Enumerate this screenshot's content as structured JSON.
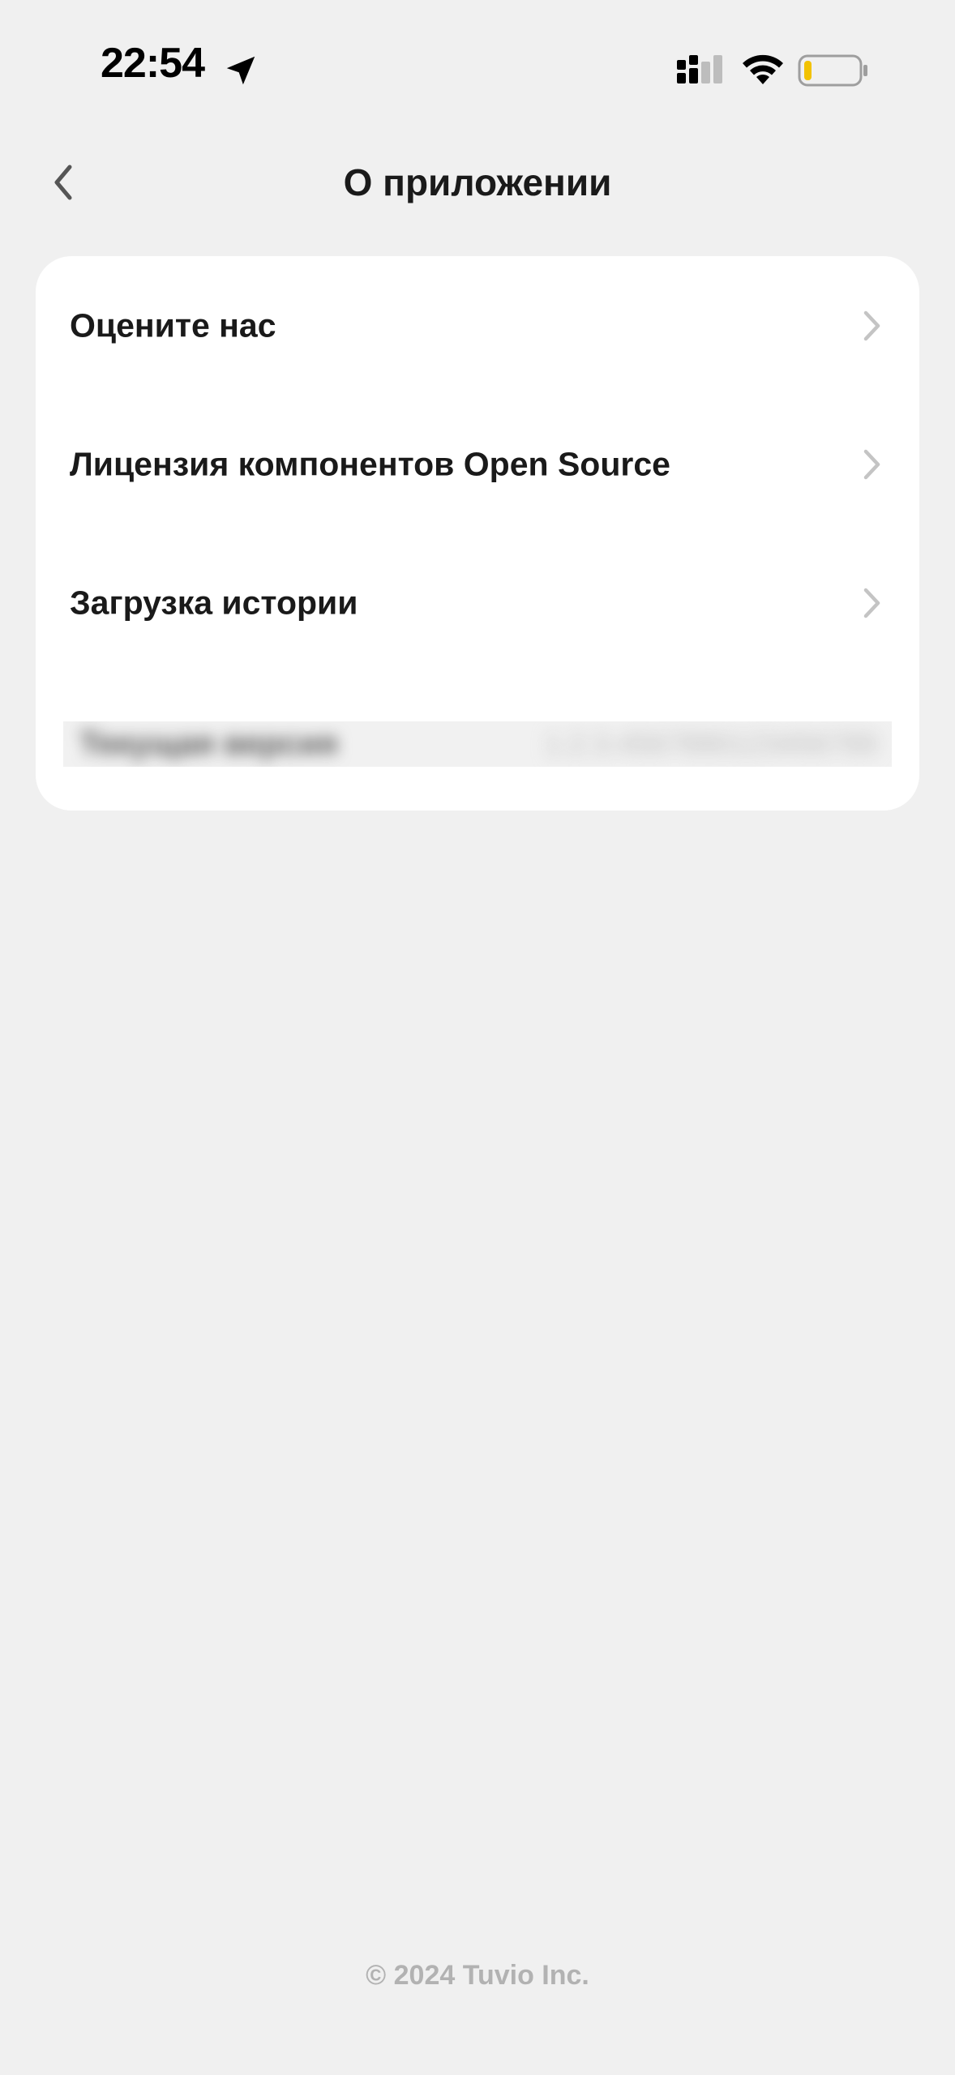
{
  "status_bar": {
    "time": "22:54",
    "location_icon": "location-arrow-icon",
    "cellular_icon": "cellular-signal-icon",
    "wifi_icon": "wifi-icon",
    "battery_icon": "battery-low-icon",
    "battery_fill_color": "#f2c200"
  },
  "nav": {
    "back_icon": "chevron-left-icon",
    "title": "О приложении"
  },
  "menu": {
    "items": [
      {
        "label": "Оцените нас",
        "icon": "chevron-right-icon"
      },
      {
        "label": "Лицензия компонентов Open Source",
        "icon": "chevron-right-icon"
      },
      {
        "label": "Загрузка истории",
        "icon": "chevron-right-icon"
      }
    ],
    "version_row": {
      "label": "Текущая версия",
      "value": "1.2.3.4567890123456789",
      "blurred": true
    }
  },
  "footer": {
    "copyright": "© 2024 Tuvio Inc."
  },
  "colors": {
    "background": "#f0f0f0",
    "card": "#ffffff",
    "text_primary": "#1a1a1a",
    "text_muted": "#b2b2b2",
    "chevron": "#c4c4c4"
  }
}
